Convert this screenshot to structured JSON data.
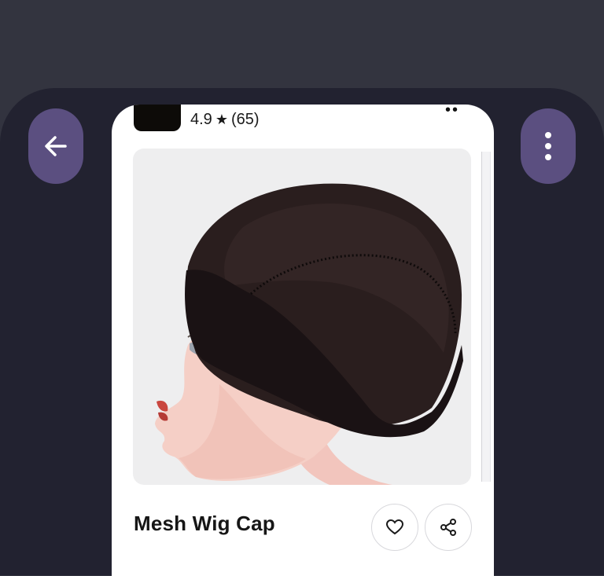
{
  "store": {
    "rating_value": "4.9",
    "rating_star": "★",
    "rating_count": "(65)"
  },
  "product": {
    "title": "Mesh Wig Cap"
  },
  "icons": {
    "back": "arrow-left-icon",
    "menu": "vertical-dots-icon",
    "wishlist": "heart-icon",
    "share": "share-icon"
  },
  "colors": {
    "accent_button": "#5b4f80",
    "panel_background": "#222230",
    "top_background": "#33343f"
  }
}
